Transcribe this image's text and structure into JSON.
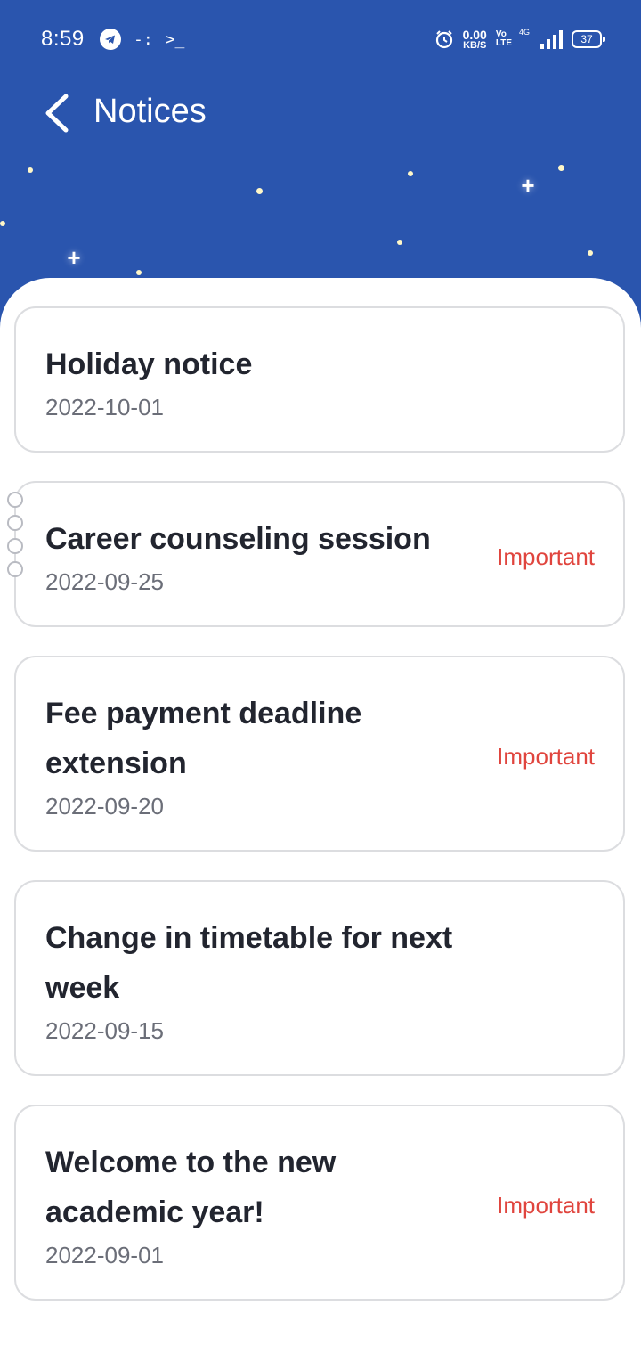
{
  "status_bar": {
    "time": "8:59",
    "terminal_glyph": ">_",
    "dots_glyph": "-:",
    "net_speed_value": "0.00",
    "net_speed_unit": "KB/S",
    "volte_top": "Vo",
    "volte_bottom": "LTE",
    "network_type": "4G",
    "battery": "37"
  },
  "header": {
    "title": "Notices",
    "background_color": "#2a55ae"
  },
  "notices": [
    {
      "title": "Holiday notice",
      "date": "2022-10-01",
      "badge": ""
    },
    {
      "title": "Career counseling session",
      "date": "2022-09-25",
      "badge": "Important"
    },
    {
      "title": "Fee payment deadline extension",
      "date": "2022-09-20",
      "badge": "Important"
    },
    {
      "title": "Change in timetable for next week",
      "date": "2022-09-15",
      "badge": ""
    },
    {
      "title": "Welcome to the new academic year!",
      "date": "2022-09-01",
      "badge": "Important"
    }
  ],
  "colors": {
    "important": "#e0453e",
    "card_border": "#dcdde0",
    "title_text": "#22252f",
    "date_text": "#6b6e78"
  },
  "icons": {
    "back": "chevron-left-icon",
    "telegram": "telegram-icon",
    "alarm": "alarm-icon",
    "signal": "signal-icon",
    "battery": "battery-icon"
  }
}
